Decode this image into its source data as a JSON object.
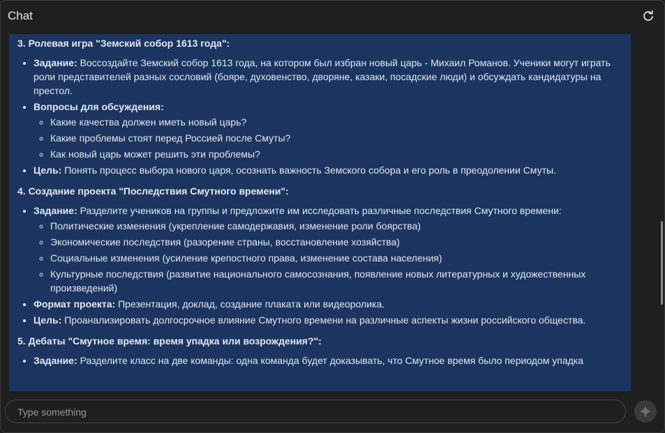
{
  "header": {
    "title": "Chat",
    "refresh_icon": "refresh-icon"
  },
  "content": {
    "s3": {
      "heading": "3. Ролевая игра \"Земский собор 1613 года\":",
      "task_label": "Задание:",
      "task_text": " Воссоздайте Земский собор 1613 года, на котором был избран новый царь - Михаил Романов. Ученики могут играть роли представителей разных сословий (бояре, духовенство, дворяне, казаки, посадские люди) и обсуждать кандидатуры на престол.",
      "questions_label": "Вопросы для обсуждения:",
      "questions": [
        "Какие качества должен иметь новый царь?",
        "Какие проблемы стоят перед Россией после Смуты?",
        "Как новый царь может решить эти проблемы?"
      ],
      "goal_label": "Цель:",
      "goal_text": " Понять процесс выбора нового царя, осознать важность Земского собора и его роль в преодолении Смуты."
    },
    "s4": {
      "heading": "4. Создание проекта \"Последствия Смутного времени\":",
      "task_label": "Задание:",
      "task_text": " Разделите учеников на группы и предложите им исследовать различные последствия Смутного времени:",
      "items": [
        "Политические изменения (укрепление самодержавия, изменение роли боярства)",
        "Экономические последствия (разорение страны, восстановление хозяйства)",
        "Социальные изменения (усиление крепостного права, изменение состава населения)",
        "Культурные последствия (развитие национального самосознания, появление новых литературных и художественных произведений)"
      ],
      "format_label": "Формат проекта:",
      "format_text": " Презентация, доклад, создание плаката или видеоролика.",
      "goal_label": "Цель:",
      "goal_text": " Проанализировать долгосрочное влияние Смутного времени на различные аспекты жизни российского общества."
    },
    "s5": {
      "heading": "5. Дебаты \"Смутное время: время упадка или возрождения?\":",
      "task_label": "Задание:",
      "task_text": " Разделите класс на две команды: одна команда будет доказывать, что Смутное время было периодом упадка"
    }
  },
  "input": {
    "placeholder": "Type something",
    "value": ""
  },
  "send_icon": "sparkle-icon"
}
